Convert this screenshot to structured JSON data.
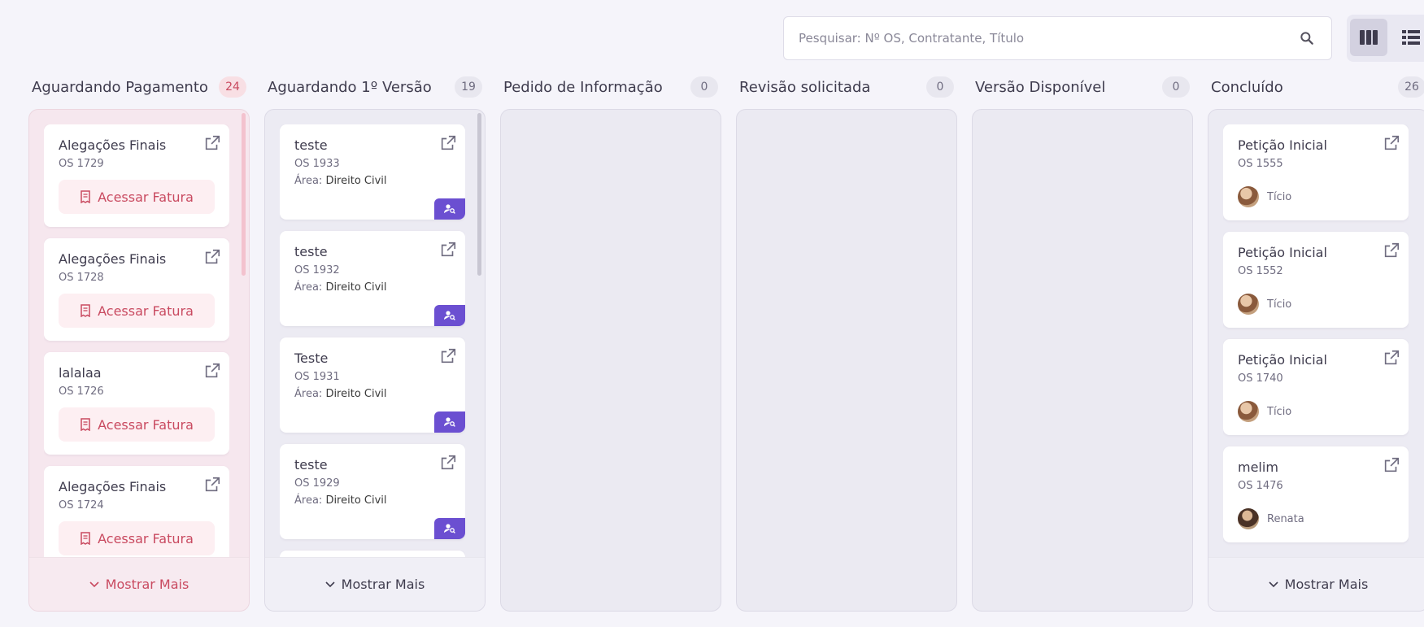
{
  "search": {
    "placeholder": "Pesquisar: Nº OS, Contratante, Título"
  },
  "view_toggle": {
    "active": "kanban",
    "options": [
      "kanban-icon",
      "list-icon"
    ]
  },
  "columns": [
    {
      "title": "Aguardando Pagamento",
      "count": "24",
      "cards": [
        {
          "title": "Alegações Finais",
          "os": "OS 1729",
          "action": "Acessar Fatura"
        },
        {
          "title": "Alegações Finais",
          "os": "OS 1728",
          "action": "Acessar Fatura"
        },
        {
          "title": "lalalaa",
          "os": "OS 1726",
          "action": "Acessar Fatura"
        },
        {
          "title": "Alegações Finais",
          "os": "OS 1724",
          "action": "Acessar Fatura"
        }
      ],
      "footer": "Mostrar Mais"
    },
    {
      "title": "Aguardando 1º Versão",
      "count": "19",
      "cards": [
        {
          "title": "teste",
          "os": "OS 1933",
          "area_label": "Área:",
          "area": "Direito Civil"
        },
        {
          "title": "teste",
          "os": "OS 1932",
          "area_label": "Área:",
          "area": "Direito Civil"
        },
        {
          "title": "Teste",
          "os": "OS 1931",
          "area_label": "Área:",
          "area": "Direito Civil"
        },
        {
          "title": "teste",
          "os": "OS 1929",
          "area_label": "Área:",
          "area": "Direito Civil"
        }
      ],
      "footer": "Mostrar Mais"
    },
    {
      "title": "Pedido de Informação",
      "count": "0"
    },
    {
      "title": "Revisão solicitada",
      "count": "0"
    },
    {
      "title": "Versão Disponível",
      "count": "0"
    },
    {
      "title": "Concluído",
      "count": "26",
      "cards": [
        {
          "title": "Petição Inicial",
          "os": "OS 1555",
          "person": "Tício"
        },
        {
          "title": "Petição Inicial",
          "os": "OS 1552",
          "person": "Tício"
        },
        {
          "title": "Petição Inicial",
          "os": "OS 1740",
          "person": "Tício"
        },
        {
          "title": "melim",
          "os": "OS 1476",
          "person": "Renata"
        }
      ],
      "footer": "Mostrar Mais"
    }
  ],
  "colors": {
    "accent_pink": "#c94a60",
    "badge_purple": "#6b4fd1"
  }
}
